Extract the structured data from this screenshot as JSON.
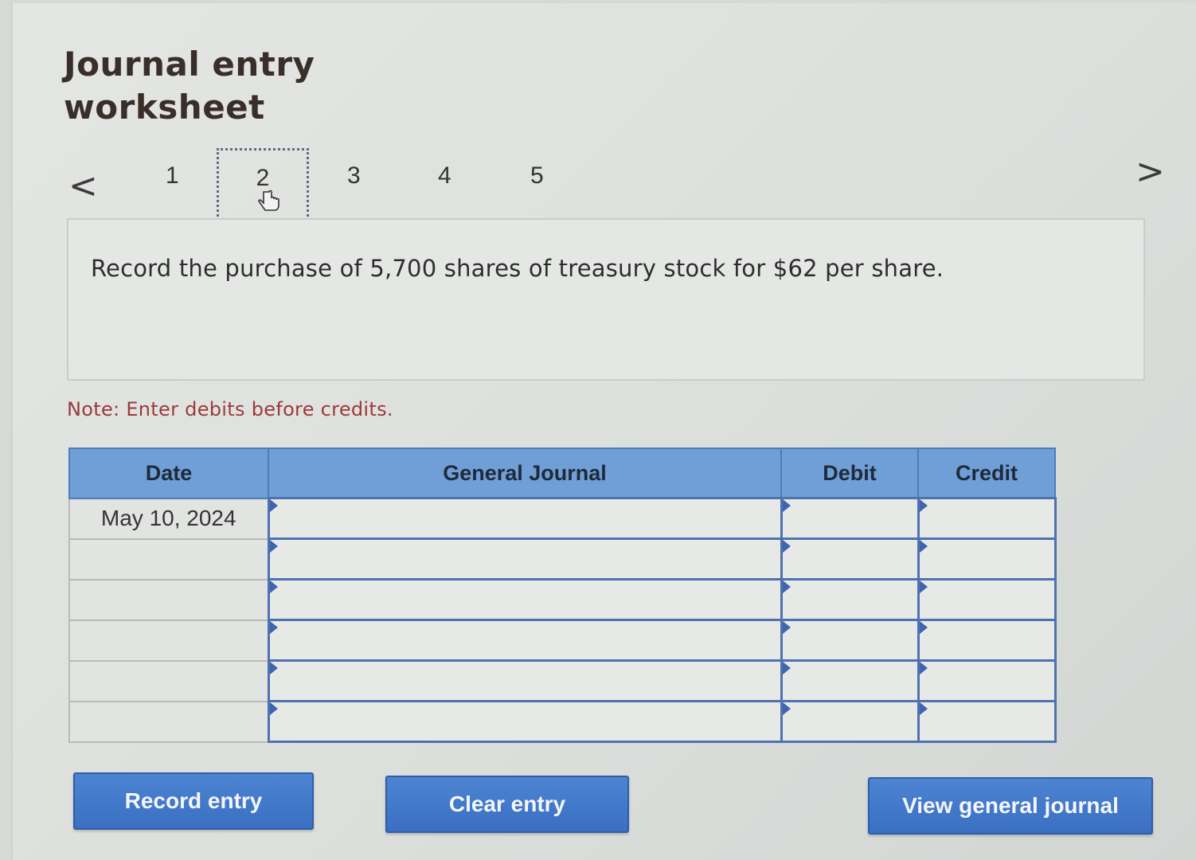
{
  "title": "Journal entry worksheet",
  "pager": {
    "prev_icon": "chevron-left-icon",
    "next_icon": "chevron-right-icon",
    "prev_glyph": "<",
    "next_glyph": ">",
    "pages": [
      "1",
      "2",
      "3",
      "4",
      "5"
    ],
    "active_page": "2"
  },
  "question": {
    "text": "Record the purchase of 5,700 shares of treasury stock for $62 per share."
  },
  "note": "Note: Enter debits before credits.",
  "journal_table": {
    "headers": {
      "date": "Date",
      "general_journal": "General Journal",
      "debit": "Debit",
      "credit": "Credit"
    },
    "rows": [
      {
        "date": "May 10, 2024",
        "account": "",
        "debit": "",
        "credit": ""
      },
      {
        "date": "",
        "account": "",
        "debit": "",
        "credit": ""
      },
      {
        "date": "",
        "account": "",
        "debit": "",
        "credit": ""
      },
      {
        "date": "",
        "account": "",
        "debit": "",
        "credit": ""
      },
      {
        "date": "",
        "account": "",
        "debit": "",
        "credit": ""
      },
      {
        "date": "",
        "account": "",
        "debit": "",
        "credit": ""
      }
    ]
  },
  "buttons": {
    "record": "Record entry",
    "clear": "Clear entry",
    "view": "View general journal"
  },
  "colors": {
    "header_bg": "#6f9fd6",
    "button_bg": "#3f74c6",
    "note_text": "#9b3a3a",
    "cell_border": "#4e72b0"
  }
}
